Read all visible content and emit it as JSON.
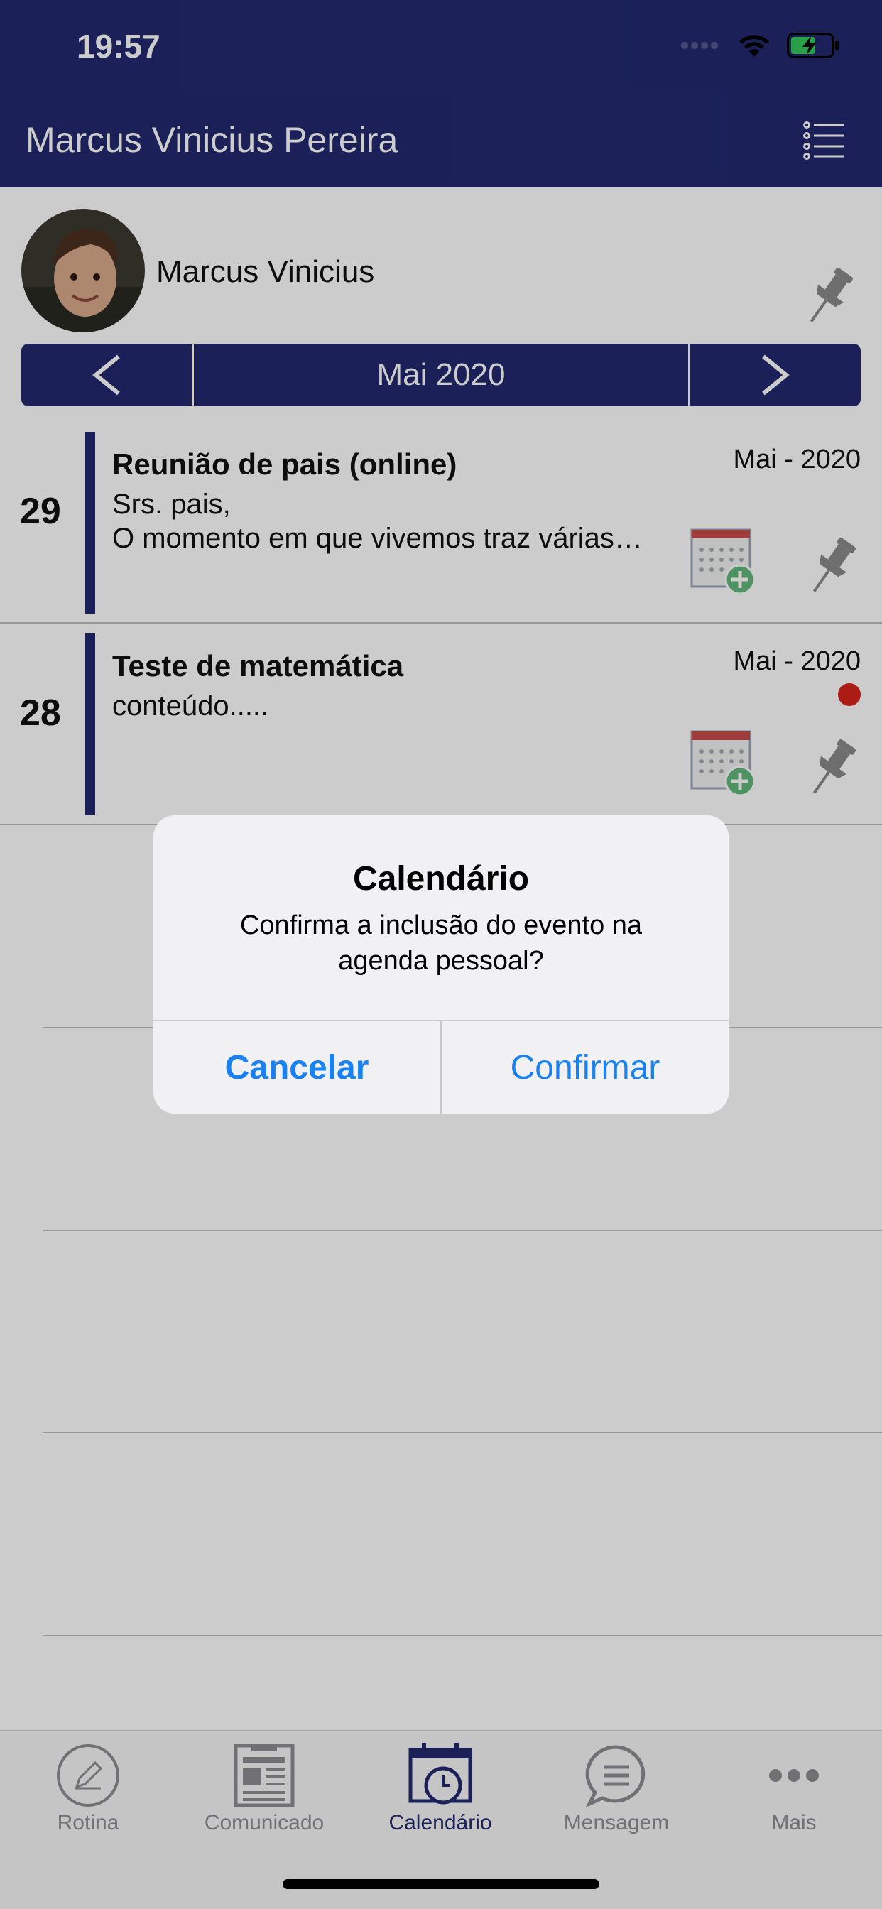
{
  "status_bar": {
    "time": "19:57"
  },
  "header": {
    "title": "Marcus Vinicius Pereira",
    "menu_icon": "list-icon"
  },
  "profile": {
    "name": "Marcus Vinicius",
    "pin_icon": "pushpin-icon"
  },
  "month_nav": {
    "label": "Mai 2020",
    "prev_icon": "chevron-left-icon",
    "next_icon": "chevron-right-icon"
  },
  "events": [
    {
      "day": "29",
      "title": "Reunião de pais (online)",
      "date": "Mai - 2020",
      "body": "Srs. pais,\nO momento em que vivemos traz várias…",
      "unread": false
    },
    {
      "day": "28",
      "title": "Teste de matemática",
      "date": "Mai - 2020",
      "body": "conteúdo.....",
      "unread": true
    }
  ],
  "dialog": {
    "title": "Calendário",
    "message": "Confirma a inclusão do evento na agenda pessoal?",
    "cancel_label": "Cancelar",
    "confirm_label": "Confirmar"
  },
  "tabs": [
    {
      "label": "Rotina",
      "icon": "pencil-circle-icon",
      "active": false
    },
    {
      "label": "Comunicado",
      "icon": "newspaper-icon",
      "active": false
    },
    {
      "label": "Calendário",
      "icon": "calendar-clock-icon",
      "active": true
    },
    {
      "label": "Mensagem",
      "icon": "chat-bubble-icon",
      "active": false
    },
    {
      "label": "Mais",
      "icon": "more-dots-icon",
      "active": false
    }
  ],
  "colors": {
    "brand": "#222a6e",
    "accent_blue": "#1a82f0",
    "unread_dot": "#d8221a",
    "tab_inactive": "#8e8e93"
  }
}
